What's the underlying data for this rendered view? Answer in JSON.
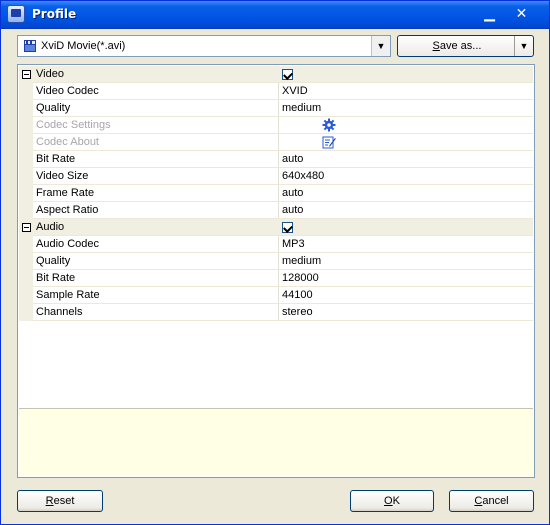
{
  "window": {
    "title": "Profile",
    "minimize_glyph": "▁",
    "close_glyph": "✕"
  },
  "profile_select": {
    "icon": "clapperboard-icon",
    "value": "XviD Movie(*.avi)",
    "arrow": "▼"
  },
  "save_as": {
    "mnemonic": "S",
    "rest": "ave as...",
    "arrow": "▼"
  },
  "properties": {
    "video_group": {
      "label": "Video",
      "enabled": true
    },
    "video_rows": [
      {
        "label": "Video Codec",
        "value": "XVID"
      },
      {
        "label": "Quality",
        "value": "medium"
      },
      {
        "label": "Codec Settings",
        "icon": "gear-icon",
        "disabled": true
      },
      {
        "label": "Codec About",
        "icon": "edit-icon",
        "disabled": true
      },
      {
        "label": "Bit Rate",
        "value": "auto"
      },
      {
        "label": "Video Size",
        "value": "640x480"
      },
      {
        "label": "Frame Rate",
        "value": "auto"
      },
      {
        "label": "Aspect Ratio",
        "value": "auto"
      }
    ],
    "audio_group": {
      "label": "Audio",
      "enabled": true
    },
    "audio_rows": [
      {
        "label": "Audio Codec",
        "value": "MP3"
      },
      {
        "label": "Quality",
        "value": "medium"
      },
      {
        "label": "Bit Rate",
        "value": "128000"
      },
      {
        "label": "Sample Rate",
        "value": "44100"
      },
      {
        "label": "Channels",
        "value": "stereo"
      }
    ]
  },
  "buttons": {
    "reset": {
      "mnemonic": "R",
      "rest": "eset"
    },
    "ok": {
      "mnemonic": "O",
      "rest": "K"
    },
    "cancel": {
      "mnemonic": "C",
      "rest": "ancel"
    }
  },
  "colors": {
    "title_bar": "#0055e5",
    "dialog_bg": "#ece9d8",
    "group_row_bg": "#f1efe2",
    "description_bg": "#ffffe6",
    "disabled_text": "#a7a6aa"
  }
}
